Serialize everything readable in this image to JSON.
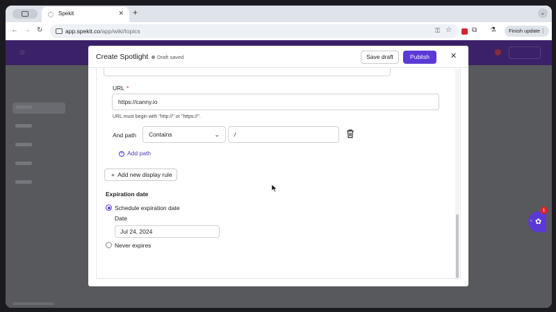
{
  "browser": {
    "tab_title": "Spekit",
    "tab_close": "✕",
    "new_tab": "+",
    "url_host": "app.spekit.co",
    "url_path": "/app/wiki/topics",
    "finish_update": "Finish update",
    "menu_dots": "⋮",
    "nav_back": "←",
    "nav_forward": "→",
    "nav_reload": "↻",
    "tab_menu": "⌄"
  },
  "modal": {
    "title": "Create Spotlight",
    "status": "Draft saved",
    "save_draft": "Save draft",
    "publish": "Publish",
    "close": "✕",
    "url_label": "URL",
    "required_mark": "*",
    "url_value": "https://canny.io",
    "url_hint": "URL must begin with \"http://\" or \"https://\".",
    "path_label": "And path",
    "path_operator": "Contains",
    "path_value": "/",
    "add_path": "Add path",
    "add_rule": "Add new display rule",
    "expiration_label": "Expiration date",
    "option_schedule": "Schedule expiration date",
    "date_label": "Date",
    "date_value": "Jul 24, 2024",
    "option_never": "Never expires"
  },
  "notification_count": "1",
  "colors": {
    "brand_purple": "#5b39d6",
    "required_red": "#d9252f"
  },
  "icons": {
    "trash": "trash-icon",
    "add": "plus-icon",
    "close": "close-icon",
    "chevron": "chevron-down-icon"
  }
}
